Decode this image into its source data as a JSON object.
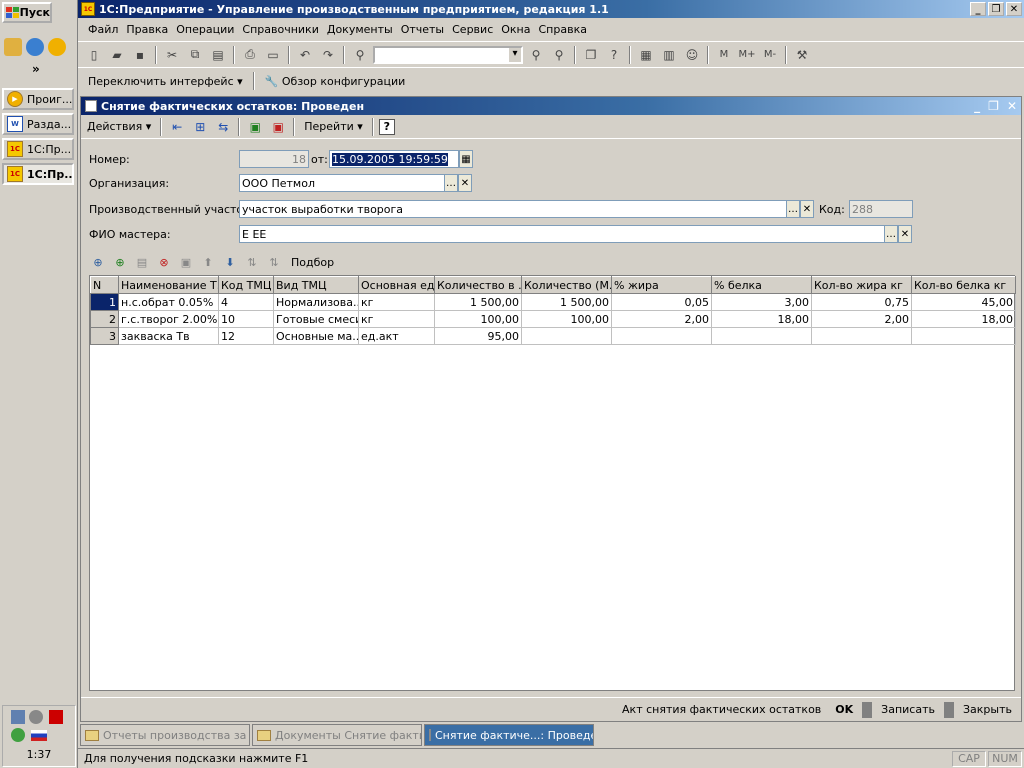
{
  "taskbar": {
    "start_label": "Пуск",
    "quick_more": "»",
    "buttons": [
      {
        "label": "Проиг..."
      },
      {
        "label": "Разда..."
      },
      {
        "label": "1С:Пр..."
      },
      {
        "label": "1С:Пр..."
      }
    ],
    "clock": "1:37"
  },
  "app": {
    "title": "1С:Предприятие - Управление производственным предприятием, редакция 1.1",
    "menu": [
      "Файл",
      "Правка",
      "Операции",
      "Справочники",
      "Документы",
      "Отчеты",
      "Сервис",
      "Окна",
      "Справка"
    ],
    "toolbar2": {
      "switch_interface": "Переключить интерфейс",
      "config_overview": "Обзор конфигурации"
    }
  },
  "document": {
    "title": "Снятие фактических остатков: Проведен",
    "toolbar": {
      "actions": "Действия",
      "goto": "Перейти",
      "help": "?"
    },
    "fields": {
      "number_label": "Номер:",
      "number_value": "18",
      "date_label": "от:",
      "date_value": "15.09.2005 19:59:59",
      "org_label": "Организация:",
      "org_value": "ООО Петмол",
      "area_label": "Производственный участок:",
      "area_value": "участок выработки творога",
      "code_label": "Код:",
      "code_value": "288",
      "master_label": "ФИО мастера:",
      "master_value": "Е ЕЕ"
    },
    "table_toolbar": {
      "selection": "Подбор"
    },
    "table": {
      "columns": [
        "N",
        "Наименование Т...",
        "Код ТМЦ",
        "Вид ТМЦ",
        "Основная ед...",
        "Количество в ...",
        "Количество (М...",
        "% жира",
        "% белка",
        "Кол-во жира кг",
        "Кол-во белка кг"
      ],
      "rows": [
        [
          "1",
          "н.с.обрат 0.05%",
          "4",
          "Нормализова...",
          "кг",
          "1 500,00",
          "1 500,00",
          "0,05",
          "3,00",
          "0,75",
          "45,00"
        ],
        [
          "2",
          "г.с.творог 2.00%",
          "10",
          "Готовые смеси",
          "кг",
          "100,00",
          "100,00",
          "2,00",
          "18,00",
          "2,00",
          "18,00"
        ],
        [
          "3",
          "закваска Тв",
          "12",
          "Основные ма...",
          "ед.акт",
          "95,00",
          "",
          "",
          "",
          "",
          ""
        ]
      ]
    },
    "footer": {
      "act": "Акт снятия фактических остатков",
      "ok": "OK",
      "save": "Записать",
      "close": "Закрыть"
    }
  },
  "mdi_tabs": [
    {
      "label": "Отчеты производства за с...",
      "active": false
    },
    {
      "label": "Документы Снятие фактич...",
      "active": false
    },
    {
      "label": "Снятие фактиче...: Проведен",
      "active": true
    }
  ],
  "statusbar": {
    "hint": "Для получения подсказки нажмите F1",
    "cap": "CAP",
    "num": "NUM"
  }
}
